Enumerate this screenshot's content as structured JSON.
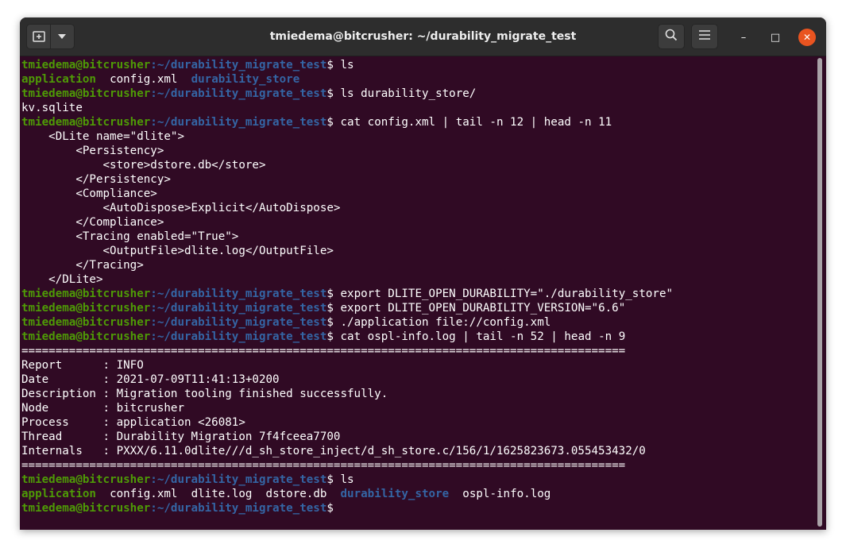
{
  "window": {
    "title": "tmiedema@bitcrusher: ~/durability_migrate_test",
    "controls": {
      "minimize": "–",
      "maximize": "□",
      "close": "✕"
    }
  },
  "toolbar": {
    "new_tab_icon": "new-tab-icon",
    "dropdown_icon": "chevron-down-icon",
    "search_icon": "search-icon",
    "menu_icon": "hamburger-menu-icon"
  },
  "colors": {
    "background": "#300a24",
    "user_host": "#4e9a06",
    "path": "#3465a4",
    "close_button": "#e95420"
  },
  "prompt": {
    "user_host": "tmiedema@bitcrusher",
    "path": ":~/durability_migrate_test",
    "symbol": "$ "
  },
  "terminal_lines": [
    {
      "type": "prompt",
      "command": "ls"
    },
    {
      "type": "ls",
      "items": [
        {
          "name": "application",
          "kind": "exec"
        },
        {
          "name": "config.xml",
          "kind": "file"
        },
        {
          "name": "durability_store",
          "kind": "dir"
        }
      ]
    },
    {
      "type": "prompt",
      "command": "ls durability_store/"
    },
    {
      "type": "text",
      "text": "kv.sqlite"
    },
    {
      "type": "prompt",
      "command": "cat config.xml | tail -n 12 | head -n 11"
    },
    {
      "type": "text",
      "text": "    <DLite name=\"dlite\">"
    },
    {
      "type": "text",
      "text": "        <Persistency>"
    },
    {
      "type": "text",
      "text": "            <store>dstore.db</store>"
    },
    {
      "type": "text",
      "text": "        </Persistency>"
    },
    {
      "type": "text",
      "text": "        <Compliance>"
    },
    {
      "type": "text",
      "text": "            <AutoDispose>Explicit</AutoDispose>"
    },
    {
      "type": "text",
      "text": "        </Compliance>"
    },
    {
      "type": "text",
      "text": "        <Tracing enabled=\"True\">"
    },
    {
      "type": "text",
      "text": "            <OutputFile>dlite.log</OutputFile>"
    },
    {
      "type": "text",
      "text": "        </Tracing>"
    },
    {
      "type": "text",
      "text": "    </DLite>"
    },
    {
      "type": "prompt",
      "command": "export DLITE_OPEN_DURABILITY=\"./durability_store\""
    },
    {
      "type": "prompt",
      "command": "export DLITE_OPEN_DURABILITY_VERSION=\"6.6\""
    },
    {
      "type": "prompt",
      "command": "./application file://config.xml"
    },
    {
      "type": "prompt",
      "command": "cat ospl-info.log | tail -n 52 | head -n 9"
    },
    {
      "type": "text",
      "text": "========================================================================================="
    },
    {
      "type": "text",
      "text": "Report      : INFO"
    },
    {
      "type": "text",
      "text": "Date        : 2021-07-09T11:41:13+0200"
    },
    {
      "type": "text",
      "text": "Description : Migration tooling finished successfully."
    },
    {
      "type": "text",
      "text": "Node        : bitcrusher"
    },
    {
      "type": "text",
      "text": "Process     : application <26081>"
    },
    {
      "type": "text",
      "text": "Thread      : Durability Migration 7f4fceea7700"
    },
    {
      "type": "text",
      "text": "Internals   : PXXX/6.11.0dlite///d_sh_store_inject/d_sh_store.c/156/1/1625823673.055453432/0"
    },
    {
      "type": "text",
      "text": "========================================================================================="
    },
    {
      "type": "prompt",
      "command": "ls"
    },
    {
      "type": "ls",
      "items": [
        {
          "name": "application",
          "kind": "exec"
        },
        {
          "name": "config.xml",
          "kind": "file"
        },
        {
          "name": "dlite.log",
          "kind": "file"
        },
        {
          "name": "dstore.db",
          "kind": "file"
        },
        {
          "name": "durability_store",
          "kind": "dir"
        },
        {
          "name": "ospl-info.log",
          "kind": "file"
        }
      ]
    },
    {
      "type": "prompt",
      "command": ""
    }
  ]
}
